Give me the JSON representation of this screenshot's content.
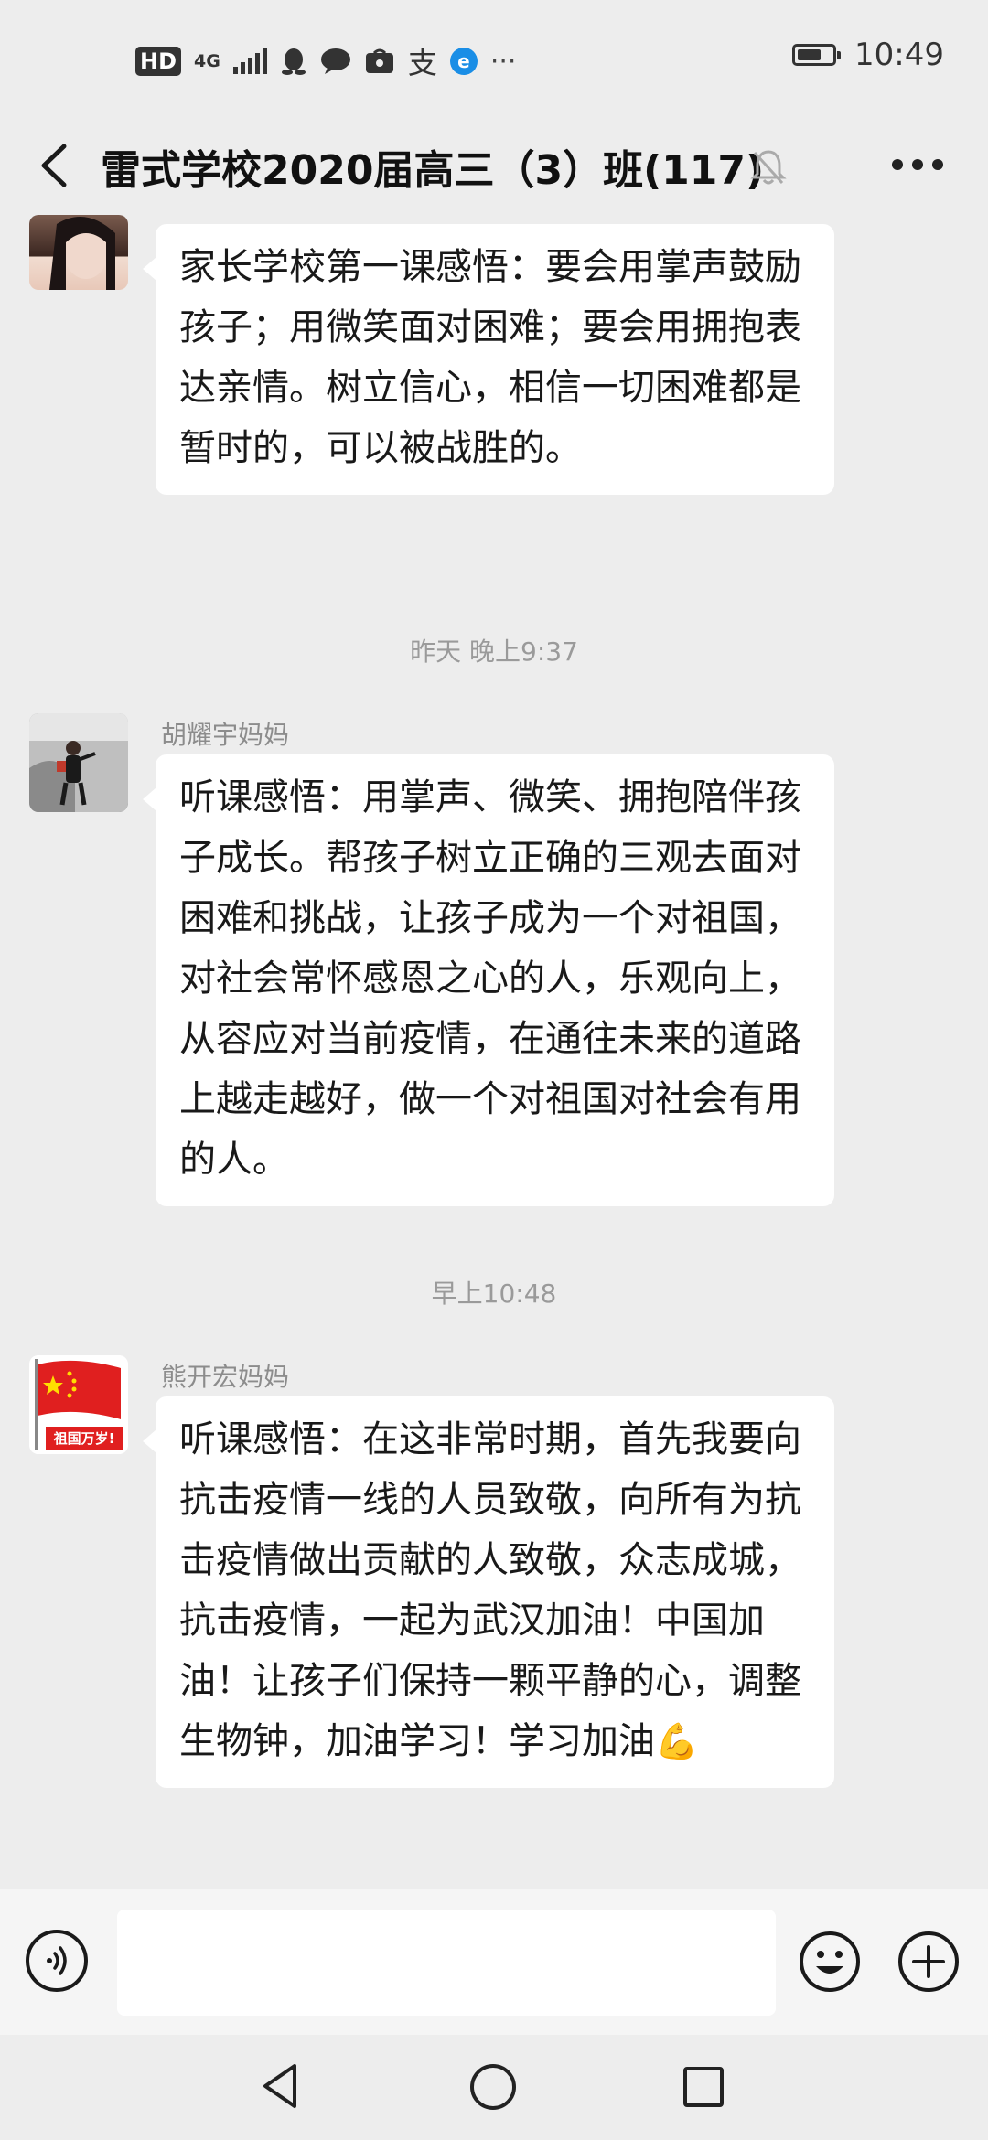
{
  "status_bar": {
    "hd": "HD",
    "network": "4G",
    "time": "10:49",
    "battery_level": 0.7,
    "icons": [
      "hd-icon",
      "signal-icon",
      "qq-icon",
      "chat-icon",
      "huawei-icon",
      "alipay-icon",
      "browser-icon",
      "more-dots-icon",
      "battery-icon"
    ]
  },
  "header": {
    "title": "雷式学校2020届高三（3）班(117)",
    "icons": [
      "back-icon",
      "mute-bell-icon",
      "more-icon"
    ]
  },
  "messages": [
    {
      "sender": "",
      "text": "家长学校第一课感悟：要会用掌声鼓励孩子；用微笑面对困难；要会用拥抱表达亲情。树立信心，相信一切困难都是暂时的，可以被战胜的。"
    },
    {
      "timestamp": "昨天 晚上9:37",
      "sender": "胡耀宇妈妈",
      "text": "听课感悟：用掌声、微笑、拥抱陪伴孩子成长。帮孩子树立正确的三观去面对困难和挑战，让孩子成为一个对祖国，对社会常怀感恩之心的人，乐观向上，从容应对当前疫情，在通往未来的道路上越走越好，做一个对祖国对社会有用的人。"
    },
    {
      "timestamp": "早上10:48",
      "sender": "熊开宏妈妈",
      "avatar_text": "祖国万岁!",
      "text": "听课感悟：在这非常时期，首先我要向抗击疫情一线的人员致敬，向所有为抗击疫情做出贡献的人致敬，众志成城，抗击疫情，一起为武汉加油！中国加油！让孩子们保持一颗平静的心，调整生物钟，加油学习！学习加油",
      "emoji": "💪"
    }
  ],
  "input_bar": {
    "value": "",
    "icons": [
      "voice-icon",
      "emoji-icon",
      "plus-icon"
    ]
  },
  "nav_bar": {
    "icons": [
      "nav-back-icon",
      "nav-home-icon",
      "nav-recents-icon"
    ]
  }
}
